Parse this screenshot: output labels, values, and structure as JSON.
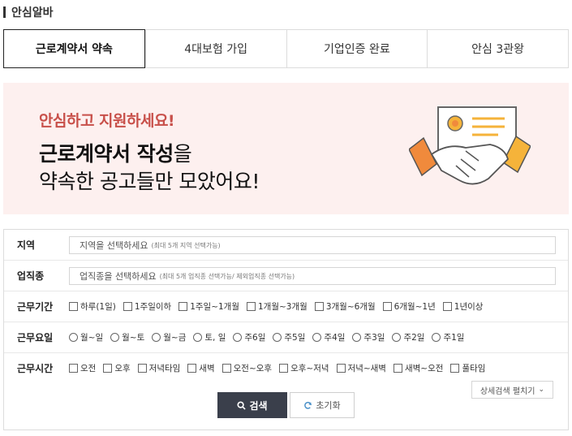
{
  "section": {
    "title": "안심알바"
  },
  "tabs": [
    {
      "label": "근로계약서 약속",
      "active": true
    },
    {
      "label": "4대보험 가입",
      "active": false
    },
    {
      "label": "기업인증 완료",
      "active": false
    },
    {
      "label": "안심 3관왕",
      "active": false
    }
  ],
  "banner": {
    "tagline": "안심하고 지원하세요!",
    "headline_bold": "근로계약서 작성",
    "headline_rest": "을",
    "headline2": "약속한 공고들만 모았어요!"
  },
  "filters": {
    "region": {
      "label": "지역",
      "placeholder": "지역을 선택하세요",
      "hint": "(최대 5개 지역 선택가능)"
    },
    "job": {
      "label": "업직종",
      "placeholder": "업직종을 선택하세요",
      "hint": "(최대 5개 업직종 선택가능/ 제외업직종 선택가능)"
    },
    "period": {
      "label": "근무기간",
      "options": [
        "하루(1일)",
        "1주일이하",
        "1주일~1개월",
        "1개월~3개월",
        "3개월~6개월",
        "6개월~1년",
        "1년이상"
      ]
    },
    "days": {
      "label": "근무요일",
      "options": [
        "월~일",
        "월~토",
        "월~금",
        "토, 일",
        "주6일",
        "주5일",
        "주4일",
        "주3일",
        "주2일",
        "주1일"
      ]
    },
    "time": {
      "label": "근무시간",
      "options": [
        "오전",
        "오후",
        "저녁타임",
        "새벽",
        "오전~오후",
        "오후~저녁",
        "저녁~새벽",
        "새벽~오전",
        "풀타임"
      ]
    }
  },
  "actions": {
    "detail_toggle": "상세검색 펼치기",
    "search": "검색",
    "reset": "초기화"
  },
  "colors": {
    "active_border": "#222222",
    "banner_bg": "#fdf0ef",
    "tagline": "#c8504a",
    "search_btn": "#3a3f4b"
  }
}
